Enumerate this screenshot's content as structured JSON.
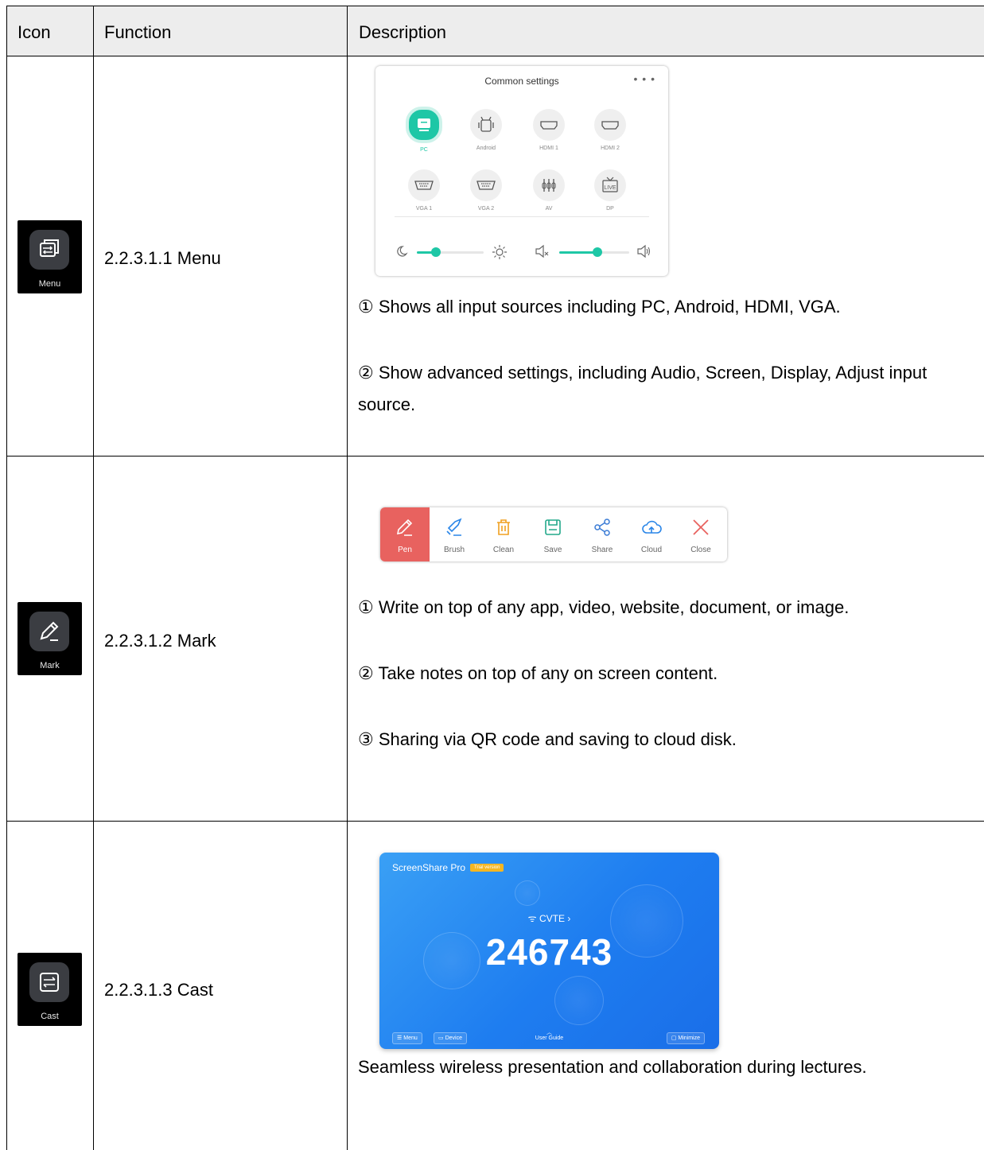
{
  "headers": {
    "icon": "Icon",
    "function": "Function",
    "description": "Description"
  },
  "rows": [
    {
      "tile_label": "Menu",
      "function": "2.2.3.1.1 Menu",
      "desc": [
        "① Shows all input sources including PC, Android, HDMI, VGA.",
        "② Show advanced settings, including Audio, Screen, Display, Adjust input source."
      ]
    },
    {
      "tile_label": "Mark",
      "function": "2.2.3.1.2 Mark",
      "desc": [
        "① Write on top of any app, video, website, document, or image.",
        "② Take notes on top of any on screen content.",
        "③ Sharing via QR code and saving to cloud disk."
      ]
    },
    {
      "tile_label": "Cast",
      "function": "2.2.3.1.3 Cast",
      "desc": [
        "Seamless wireless presentation and collaboration during lectures."
      ]
    }
  ],
  "settings_panel": {
    "title": "Common settings",
    "more": "• • •",
    "sources": [
      "PC",
      "Android",
      "HDMI 1",
      "HDMI 2",
      "VGA 1",
      "VGA 2",
      "AV",
      "DP"
    ],
    "active_source": "PC",
    "brightness_level": 0.28,
    "volume_level": 0.55,
    "accent_color": "#1ec7a6"
  },
  "mark_toolbar": {
    "tools": [
      {
        "label": "Pen",
        "icon": "pen-icon",
        "color": "#ffffff"
      },
      {
        "label": "Brush",
        "icon": "brush-icon",
        "color": "#2a86e8"
      },
      {
        "label": "Clean",
        "icon": "trash-icon",
        "color": "#f0a020"
      },
      {
        "label": "Save",
        "icon": "save-icon",
        "color": "#22a88a"
      },
      {
        "label": "Share",
        "icon": "share-icon",
        "color": "#3a7bd5"
      },
      {
        "label": "Cloud",
        "icon": "cloud-icon",
        "color": "#2a86e8"
      },
      {
        "label": "Close",
        "icon": "close-icon",
        "color": "#e8625f"
      }
    ],
    "active_tool": "Pen",
    "active_color": "#e8625f"
  },
  "screenshare": {
    "title": "ScreenShare Pro",
    "badge": "Trial version",
    "network": "CVTE",
    "code": "246743",
    "menu_button": "Menu",
    "device_button": "Device",
    "guide_label": "User Guide",
    "minimize_button": "Minimize"
  }
}
